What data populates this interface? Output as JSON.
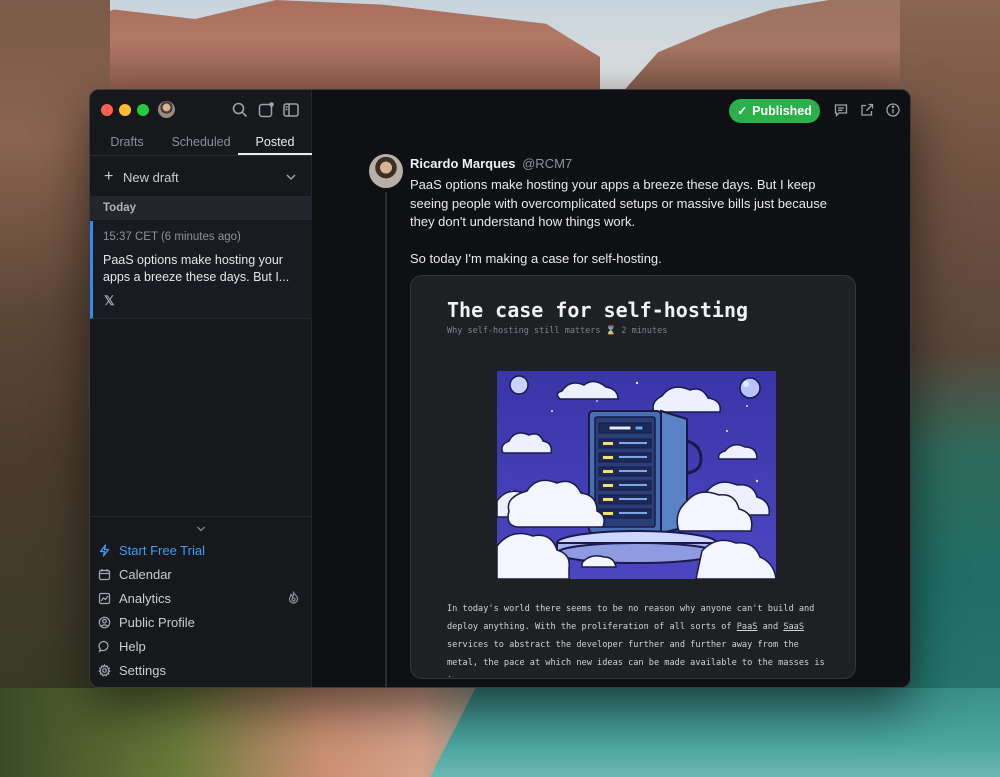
{
  "sidebar": {
    "tabs": [
      {
        "label": "Drafts",
        "active": false
      },
      {
        "label": "Scheduled",
        "active": false
      },
      {
        "label": "Posted",
        "active": true
      }
    ],
    "new_draft_label": "New draft",
    "section_label": "Today",
    "items": [
      {
        "time": "15:37 CET (6 minutes ago)",
        "preview": "PaaS options make hosting your apps a breeze these days. But I...",
        "platform_icon": "x-icon"
      }
    ],
    "nav": [
      {
        "label": "Start Free Trial",
        "icon": "bolt-icon"
      },
      {
        "label": "Calendar",
        "icon": "calendar-icon"
      },
      {
        "label": "Analytics",
        "icon": "chart-icon"
      },
      {
        "label": "Public Profile",
        "icon": "user-circle-icon"
      },
      {
        "label": "Help",
        "icon": "chat-bubble-icon"
      },
      {
        "label": "Settings",
        "icon": "gear-icon"
      }
    ]
  },
  "header": {
    "status_label": "Published",
    "status_color": "#2bb14b"
  },
  "tweet": {
    "author_name": "Ricardo Marques",
    "author_handle": "@RCM7",
    "paragraphs": [
      "PaaS options make hosting your apps a breeze these days. But I keep seeing people with overcomplicated setups or massive bills just because they don't understand how things work.",
      "So today I'm making a case for self-hosting."
    ]
  },
  "card": {
    "title": "The case for self-hosting",
    "subtitle": "Why self-hosting still matters ⌛ 2 minutes",
    "para_before": "In today's world there seems to be no reason why anyone can't build and deploy anything. With the proliferation of all sorts of ",
    "link1": "PaaS",
    "para_and": " and ",
    "link2": "SaaS",
    "para_after": " services to abstract the developer further and further away from the metal, the pace at which new ideas can be made available to the masses is insane."
  },
  "colors": {
    "accent_blue": "#2f8cf0",
    "published_green": "#2bb14b"
  }
}
